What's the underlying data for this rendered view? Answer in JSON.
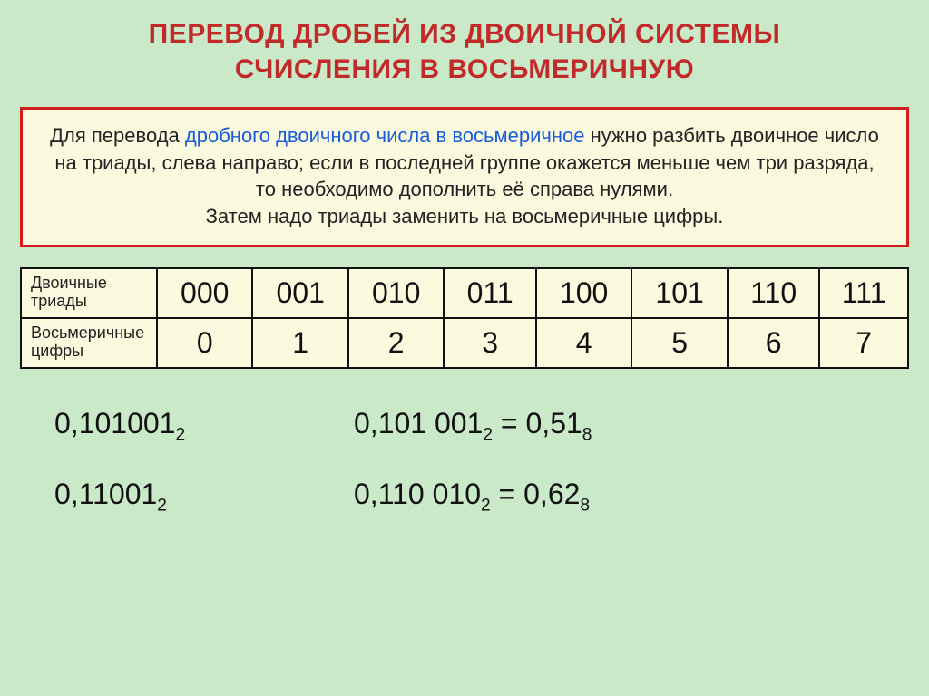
{
  "title_line1": "ПЕРЕВОД ДРОБЕЙ ИЗ ДВОИЧНОЙ СИСТЕМЫ",
  "title_line2": "СЧИСЛЕНИЯ В ВОСЬМЕРИЧНУЮ",
  "rule": {
    "part1": "Для перевода ",
    "highlight": "дробного двоичного числа в восьмеричное",
    "part2": " нужно разбить двоичное число на триады, слева направо; если в последней группе окажется меньше чем три разряда, то необходимо дополнить её справа нулями.",
    "line2": "Затем надо триады заменить на восьмеричные цифры."
  },
  "table": {
    "row1_label": "Двоичные триады",
    "row2_label": "Восьмеричные цифры",
    "triads": [
      "000",
      "001",
      "010",
      "011",
      "100",
      "101",
      "110",
      "111"
    ],
    "digits": [
      "0",
      "1",
      "2",
      "3",
      "4",
      "5",
      "6",
      "7"
    ]
  },
  "examples": [
    {
      "left_value": "0,101001",
      "left_sub": "2",
      "right_lhs": "0,101 001",
      "right_lhs_sub": "2",
      "eq": " = ",
      "right_rhs": "0,51",
      "right_rhs_sub": "8"
    },
    {
      "left_value": "0,11001",
      "left_sub": "2",
      "right_lhs": "0,110 010",
      "right_lhs_sub": "2",
      "eq": " = ",
      "right_rhs": "0,62",
      "right_rhs_sub": "8"
    }
  ],
  "chart_data": {
    "type": "table",
    "title": "Двоичные триады → Восьмеричные цифры",
    "categories": [
      "000",
      "001",
      "010",
      "011",
      "100",
      "101",
      "110",
      "111"
    ],
    "values": [
      0,
      1,
      2,
      3,
      4,
      5,
      6,
      7
    ]
  }
}
